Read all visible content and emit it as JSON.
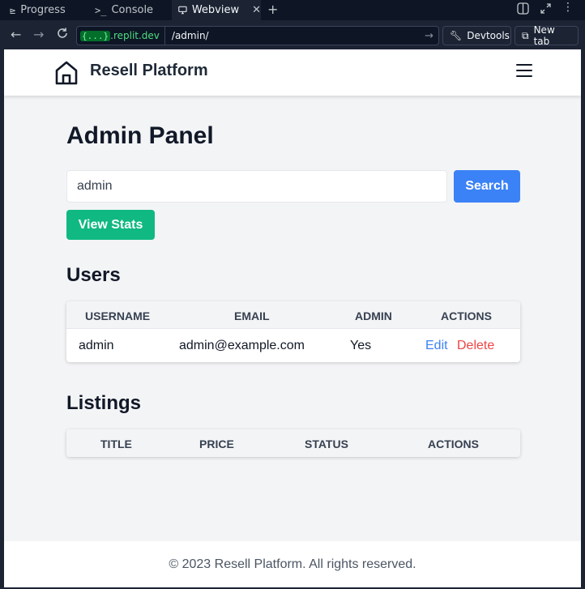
{
  "chrome": {
    "tabs": [
      {
        "label": "Progress",
        "icon": "progress-icon"
      },
      {
        "label": "Console",
        "icon": "console-icon"
      },
      {
        "label": "Webview",
        "icon": "monitor-icon"
      }
    ],
    "url_host_prefix": "{...}",
    "url_host": ".replit.dev",
    "url_path": "/admin/",
    "devtools_label": "Devtools",
    "new_tab_label": "New tab"
  },
  "header": {
    "brand": "Resell Platform",
    "logo_icon": "home-icon",
    "menu_icon": "hamburger-menu-icon"
  },
  "main": {
    "title": "Admin Panel",
    "search_value": "admin",
    "search_button": "Search",
    "view_stats_button": "View Stats"
  },
  "users": {
    "title": "Users",
    "columns": [
      "USERNAME",
      "EMAIL",
      "ADMIN",
      "ACTIONS"
    ],
    "rows": [
      {
        "username": "admin",
        "email": "admin@example.com",
        "admin": "Yes",
        "edit": "Edit",
        "delete": "Delete"
      }
    ]
  },
  "listings": {
    "title": "Listings",
    "columns": [
      "TITLE",
      "PRICE",
      "STATUS",
      "ACTIONS"
    ]
  },
  "footer": {
    "text": "© 2023 Resell Platform. All rights reserved."
  },
  "colors": {
    "primary": "#3b82f6",
    "success": "#10b981",
    "danger": "#ef4444",
    "chrome_bg": "#1c2333"
  }
}
